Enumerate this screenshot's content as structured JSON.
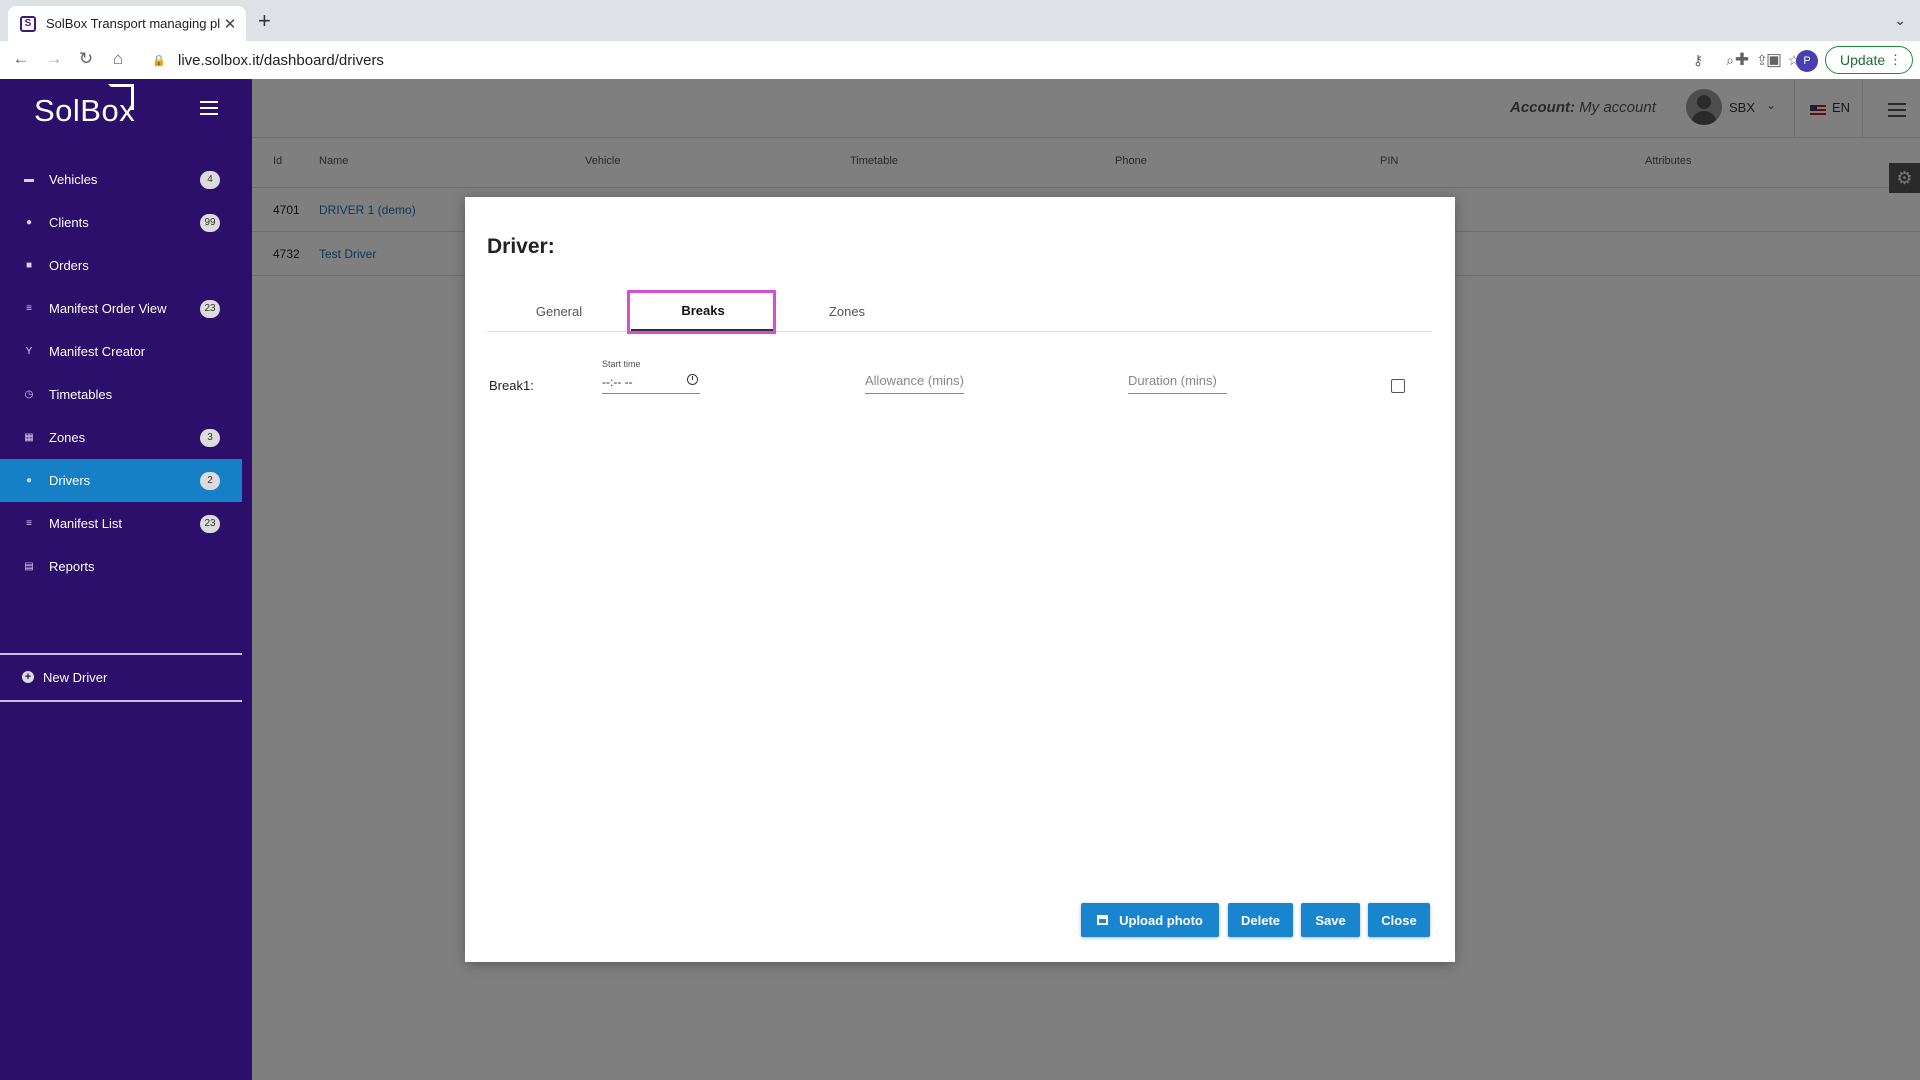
{
  "browser": {
    "tab_title": "SolBox Transport managing pla",
    "favicon": "S",
    "close_glyph": "✕",
    "newtab_glyph": "+",
    "tabsearch_glyph": "⌄",
    "back_glyph": "←",
    "forward_glyph": "→",
    "reload_glyph": "↻",
    "home_glyph": "⌂",
    "lock_glyph": "🔒",
    "url": "live.solbox.it/dashboard/drivers",
    "key_glyph": "⚷",
    "zoom_glyph": "⌕",
    "share_glyph": "⇪",
    "star_glyph": "☆",
    "ext_glyph": "✚",
    "side_glyph": "▣",
    "profile_initial": "P",
    "update_label": "Update",
    "menu_glyph": "⋮"
  },
  "sidebar": {
    "logo": "SolBox",
    "items": [
      {
        "label": "Vehicles",
        "badge": "4",
        "icon": "▬"
      },
      {
        "label": "Clients",
        "badge": "99",
        "icon": "●"
      },
      {
        "label": "Orders",
        "badge": null,
        "icon": "■"
      },
      {
        "label": "Manifest Order View",
        "badge": "23",
        "icon": "≡"
      },
      {
        "label": "Manifest Creator",
        "badge": null,
        "icon": "Y"
      },
      {
        "label": "Timetables",
        "badge": null,
        "icon": "◷"
      },
      {
        "label": "Zones",
        "badge": "3",
        "icon": "▦"
      },
      {
        "label": "Drivers",
        "badge": "2",
        "icon": "●"
      },
      {
        "label": "Manifest List",
        "badge": "23",
        "icon": "≡"
      },
      {
        "label": "Reports",
        "badge": null,
        "icon": "▤"
      }
    ],
    "new_driver_label": "New Driver",
    "plus_glyph": "+"
  },
  "topbar": {
    "account_label": "Account:",
    "account_value": "My account",
    "user": "SBX",
    "caret_glyph": "⌄",
    "language": "EN"
  },
  "table": {
    "headers": [
      "Id",
      "Name",
      "Vehicle",
      "Timetable",
      "Phone",
      "PIN",
      "Attributes"
    ],
    "rows": [
      {
        "id": "4701",
        "name": "DRIVER 1 (demo)"
      },
      {
        "id": "4732",
        "name": "Test Driver"
      }
    ],
    "gear_glyph": "⚙"
  },
  "modal": {
    "title": "Driver:",
    "tabs": [
      "General",
      "Breaks",
      "Zones"
    ],
    "active_tab": "Breaks",
    "break_label": "Break1:",
    "start_time_label": "Start time",
    "start_time_value": "--:-- --",
    "allowance_placeholder": "Allowance (mins)",
    "duration_placeholder": "Duration (mins)",
    "buttons": {
      "upload": "Upload photo",
      "delete": "Delete",
      "save": "Save",
      "close": "Close"
    }
  },
  "colors": {
    "sidebar_bg": "#2c0e6b",
    "active_item": "#1580c6",
    "button": "#1a85cf",
    "highlight": "#d54dd8"
  }
}
